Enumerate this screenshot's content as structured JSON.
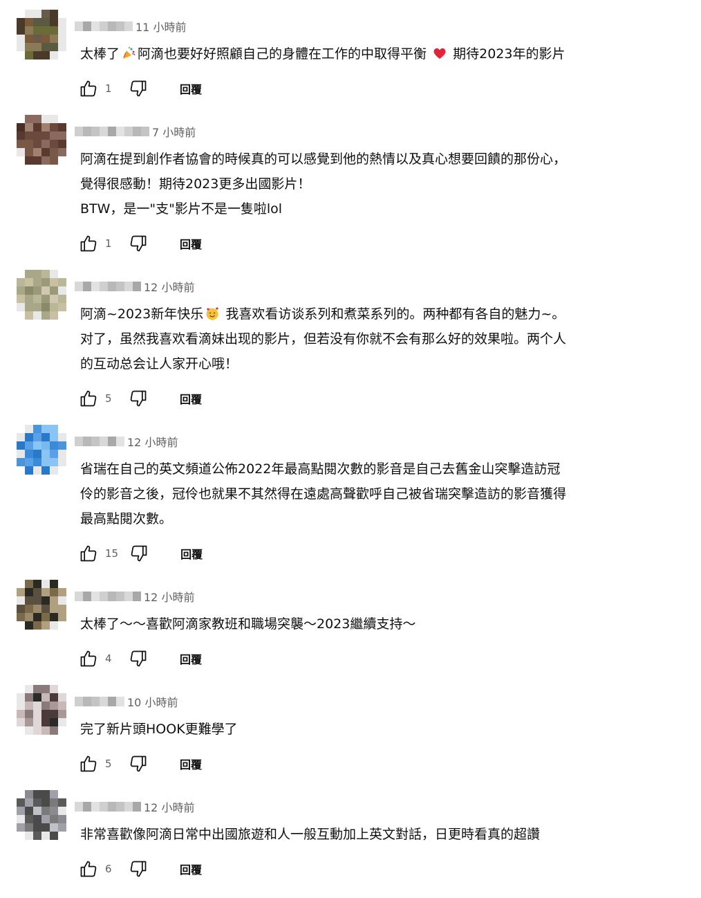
{
  "comments": [
    {
      "avatar_palette": [
        "#5a5a42",
        "#6b6b3a",
        "#8a7a55",
        "#7a5a3a",
        "#4a3a2a",
        "#6a5a4a"
      ],
      "time": "11 小時前",
      "lines": [
        "太棒了",
        "阿滴也要好好照顧自己的身體在工作的中取得平衡",
        "期待2023年的影片"
      ],
      "likes": "1",
      "reply_label": "回覆"
    },
    {
      "avatar_palette": [
        "#6b4a3e",
        "#8a6a5e",
        "#5a3a2e",
        "#a0806e",
        "#7a5848",
        "#4a2e24"
      ],
      "time": "7 小時前",
      "lines": [
        "阿滴在提到創作者協會的時候真的可以感覺到他的熱情以及真心想要回饋的那份心，",
        "覺得很感動！期待2023更多出國影片！",
        "BTW，是一\"支\"影片不是一隻啦lol"
      ],
      "likes": "1",
      "reply_label": "回覆"
    },
    {
      "avatar_palette": [
        "#9a9a7a",
        "#b8b898",
        "#c8c0a0",
        "#8a8a6a",
        "#d0c8b0",
        "#a8a888"
      ],
      "time": "12 小時前",
      "lines": [
        "阿滴~2023新年快乐",
        "我喜欢看访谈系列和煮菜系列的。两种都有各自的魅力~。",
        "对了，虽然我喜欢看滴妹出现的影片，但若没有你就不会有那么好的效果啦。两个人",
        "的互动总会让人家开心哦！"
      ],
      "likes": "5",
      "reply_label": "回覆"
    },
    {
      "avatar_palette": [
        "#3a8ad8",
        "#5aa0e8",
        "#2a78c8",
        "#7ab8f0",
        "#4a94dc",
        "#8ac4f4"
      ],
      "time": "12 小時前",
      "lines": [
        "省瑞在自己的英文頻道公佈2022年最高點閱次數的影音是自己去舊金山突擊造訪冠",
        "伶的影音之後，冠伶也就果不其然得在遠處高聲歡呼自己被省瑞突擊造訪的影音獲得",
        "最高點閱次數。"
      ],
      "likes": "15",
      "reply_label": "回覆"
    },
    {
      "avatar_palette": [
        "#4a4a3a",
        "#7a6a4a",
        "#2a2a22",
        "#9a8a6a",
        "#5a5040",
        "#b0a080"
      ],
      "time": "12 小時前",
      "lines": [
        "太棒了～～喜歡阿滴家教班和職場突襲～2023繼續支持～"
      ],
      "likes": "4",
      "reply_label": "回覆"
    },
    {
      "avatar_palette": [
        "#2a2a2a",
        "#8a7a7a",
        "#c8b8b8",
        "#4a3a3a",
        "#e0d8d8",
        "#a89898"
      ],
      "time": "10 小時前",
      "lines": [
        "完了新片頭HOOK更難學了"
      ],
      "likes": "5",
      "reply_label": "回覆"
    },
    {
      "avatar_palette": [
        "#7a7a7a",
        "#a0a0a8",
        "#5a5a5a",
        "#c0c0c8",
        "#8a8a90",
        "#4a4a4a"
      ],
      "time": "12 小時前",
      "lines": [
        "非常喜歡像阿滴日常中出國旅遊和人一般互動加上英文對話，日更時看真的超讚"
      ],
      "likes": "6",
      "reply_label": "回覆"
    }
  ],
  "colors": {
    "text": "#0f0f0f",
    "secondary": "#606060",
    "heart": "#e0243a"
  },
  "icons": [
    "like-icon",
    "dislike-icon",
    "party-popper-emoji",
    "red-heart-emoji",
    "smiling-face-with-hearts-emoji"
  ]
}
